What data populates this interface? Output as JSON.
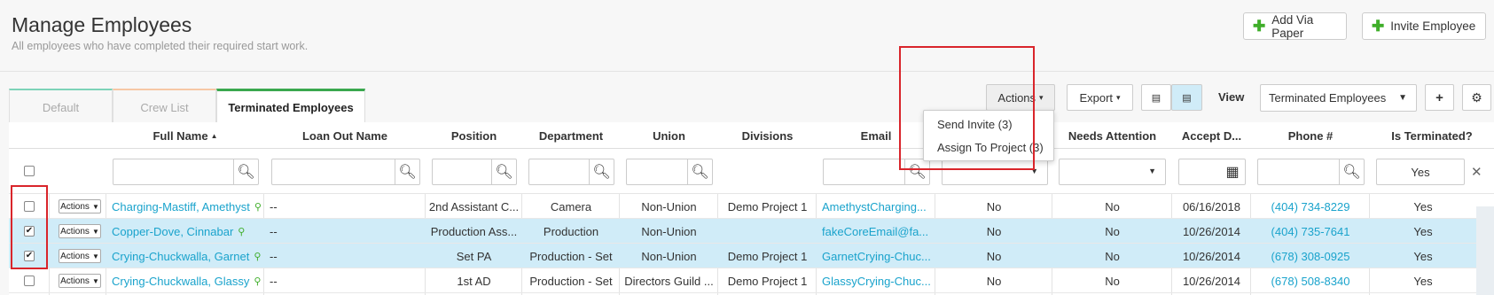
{
  "header": {
    "title": "Manage Employees",
    "subtitle": "All employees who have completed their required start work.",
    "add_via_paper": "Add Via Paper",
    "invite_employee": "Invite Employee"
  },
  "tabs": [
    "Default",
    "Crew List",
    "Terminated Employees"
  ],
  "toolbar": {
    "actions": "Actions",
    "export": "Export",
    "view_label": "View",
    "view_selected": "Terminated Employees"
  },
  "actions_menu": [
    "Send Invite (3)",
    "Assign To Project (3)"
  ],
  "columns": [
    "Full Name",
    "Loan Out Name",
    "Position",
    "Department",
    "Union",
    "Divisions",
    "Email",
    "Needs Attention",
    "Accept D...",
    "Phone #",
    "Is Terminated?"
  ],
  "sort_indicator": "▲",
  "filters": {
    "is_terminated": "Yes"
  },
  "row_action_label": "Actions",
  "rows": [
    {
      "checked": false,
      "name": "Charging-Mastiff, Amethyst",
      "loan_out": "--",
      "position": "2nd Assistant C...",
      "department": "Camera",
      "union": "Non-Union",
      "divisions": "Demo Project 1",
      "email": "AmethystCharging...",
      "col7": "No",
      "needs_attention": "No",
      "accept_date": "06/16/2018",
      "phone": "(404) 734-8229",
      "terminated": "Yes"
    },
    {
      "checked": true,
      "name": "Copper-Dove, Cinnabar",
      "loan_out": "--",
      "position": "Production Ass...",
      "department": "Production",
      "union": "Non-Union",
      "divisions": "",
      "email": "fakeCoreEmail@fa...",
      "col7": "No",
      "needs_attention": "No",
      "accept_date": "10/26/2014",
      "phone": "(404) 735-7641",
      "terminated": "Yes"
    },
    {
      "checked": true,
      "name": "Crying-Chuckwalla, Garnet",
      "loan_out": "--",
      "position": "Set PA",
      "department": "Production - Set",
      "union": "Non-Union",
      "divisions": "Demo Project 1",
      "email": "GarnetCrying-Chuc...",
      "col7": "No",
      "needs_attention": "No",
      "accept_date": "10/26/2014",
      "phone": "(678) 308-0925",
      "terminated": "Yes"
    },
    {
      "checked": false,
      "name": "Crying-Chuckwalla, Glassy",
      "loan_out": "--",
      "position": "1st AD",
      "department": "Production - Set",
      "union": "Directors Guild ...",
      "divisions": "Demo Project 1",
      "email": "GlassyCrying-Chuc...",
      "col7": "No",
      "needs_attention": "No",
      "accept_date": "10/26/2014",
      "phone": "(678) 508-8340",
      "terminated": "Yes"
    }
  ],
  "colors": {
    "accent": "#1aa3cc",
    "green": "#3fae2a",
    "selected_row": "#d0ecf8",
    "highlight": "#d9252b"
  }
}
